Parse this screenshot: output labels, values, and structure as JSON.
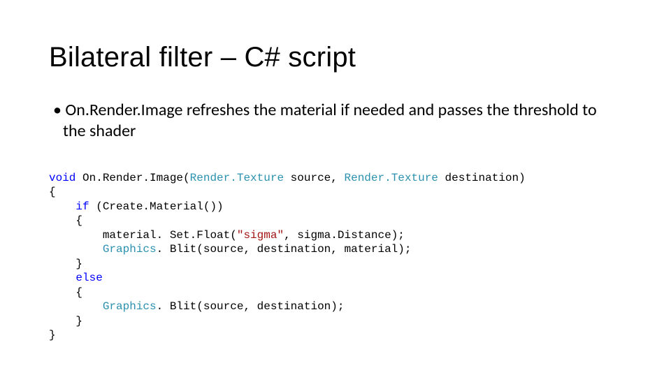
{
  "title": "Bilateral filter – C# script",
  "bullet": "On.Render.Image refreshes the material if needed and passes the threshold to the shader",
  "code": {
    "kw_void": "void",
    "fn_name": " On.Render.Image(",
    "typ1": "Render.Texture",
    "src": " source, ",
    "typ2": "Render.Texture",
    "dst": " destination)",
    "l2": "{",
    "l3a": "    ",
    "kw_if": "if",
    "l3b": " (Create.Material())",
    "l4": "    {",
    "l5a": "        material. Set.Float(",
    "str1": "\"sigma\"",
    "l5b": ", sigma.Distance);",
    "l6a": "        ",
    "typ3": "Graphics",
    "l6b": ". Blit(source, destination, material);",
    "l7": "    }",
    "l8a": "    ",
    "kw_else": "else",
    "l9": "    {",
    "l10a": "        ",
    "typ4": "Graphics",
    "l10b": ". Blit(source, destination);",
    "l11": "    }",
    "l12": "}"
  }
}
